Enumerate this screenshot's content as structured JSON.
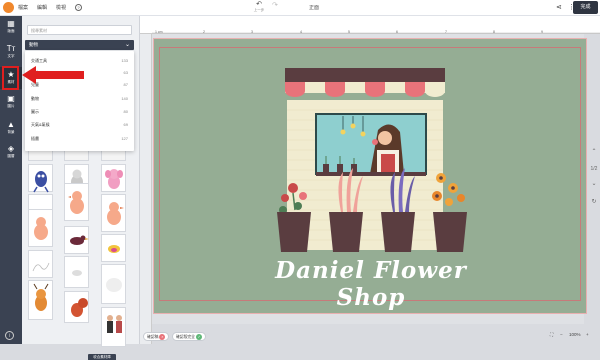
{
  "topbar": {
    "menu": [
      "檔案",
      "編輯",
      "檢視"
    ],
    "help": "?",
    "undo_label": "上一步",
    "document_title": "正面",
    "done_button": "完成"
  },
  "leftbar": {
    "items": [
      {
        "icon": "page-icon",
        "glyph": "▦",
        "label": "版面"
      },
      {
        "icon": "text-icon",
        "glyph": "Tт",
        "label": "文字"
      },
      {
        "icon": "star-icon",
        "glyph": "★",
        "label": "素材"
      },
      {
        "icon": "image-icon",
        "glyph": "▣",
        "label": "圖片"
      },
      {
        "icon": "background-icon",
        "glyph": "▲",
        "label": "背景"
      },
      {
        "icon": "layers-icon",
        "glyph": "◈",
        "label": "圖層"
      }
    ],
    "info": "i"
  },
  "panel": {
    "search_placeholder": "搜尋素材",
    "category_selected": "動物",
    "dropdown": [
      {
        "label": "交通工具",
        "count": "133"
      },
      {
        "label": "人物",
        "count": "63"
      },
      {
        "label": "兒童",
        "count": "87"
      },
      {
        "label": "動物",
        "count": "140"
      },
      {
        "label": "圖示",
        "count": "80"
      },
      {
        "label": "天氣&氣候",
        "count": "69"
      },
      {
        "label": "插畫",
        "count": "127"
      }
    ],
    "collapse_label": "收合素材庫"
  },
  "ruler": {
    "top_numbers": [
      "1 cm",
      "2",
      "3",
      "4",
      "5",
      "6",
      "7",
      "8",
      "9"
    ]
  },
  "canvas": {
    "title": "Daniel Flower Shop",
    "colors": {
      "background": "#95ad94",
      "awning": "#e8737a",
      "pot": "#5a3d40",
      "wall": "#f1ecd0",
      "window": "#8ecfcf"
    }
  },
  "right_tools": {
    "page_indicator": "1/2"
  },
  "bottom": {
    "chip1": "確認稿",
    "chip2": "確認版完全",
    "zoom_value": "100%"
  },
  "colors": {
    "accent": "#f0882d",
    "dark": "#3a4252",
    "annotation_red": "#e01f1f"
  }
}
